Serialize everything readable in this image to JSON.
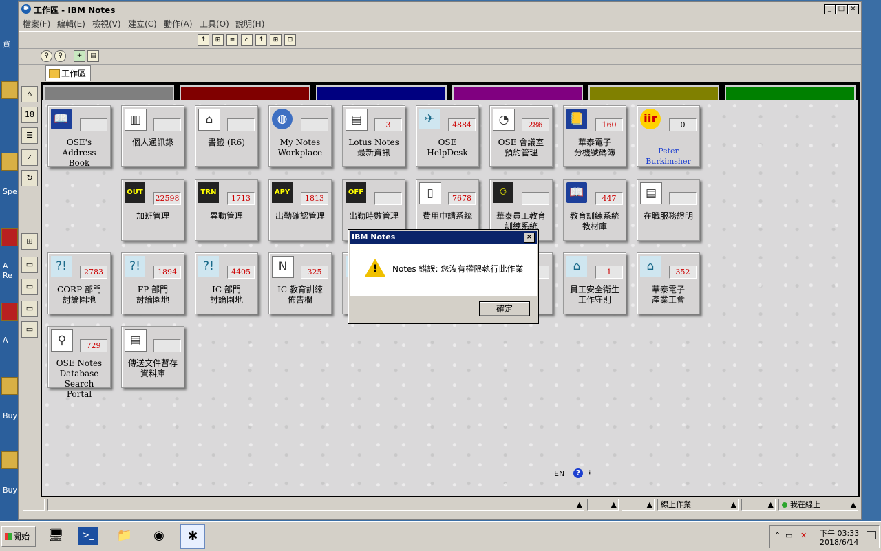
{
  "window": {
    "title": "工作區 - IBM Notes",
    "menus": [
      "檔案(F)",
      "編輯(E)",
      "檢視(V)",
      "建立(C)",
      "動作(A)",
      "工具(O)",
      "說明(H)"
    ],
    "tab_label": "工作區"
  },
  "desktop": {
    "labels": [
      "資",
      "Spe",
      "A",
      "Re",
      "A",
      "Buy",
      "Buy"
    ]
  },
  "colors": {
    "tab_colors": [
      "#7f7f7f",
      "#800000",
      "#000080",
      "#800080",
      "#808000",
      "#008000"
    ]
  },
  "tiles": [
    {
      "icon": "address-book-icon",
      "count": "",
      "label": "OSE's Address\nBook"
    },
    {
      "icon": "contacts-icon",
      "count": "",
      "label": "個人通訊錄"
    },
    {
      "icon": "bookmarks-icon",
      "count": "",
      "label": "書籤 (R6)"
    },
    {
      "icon": "workplace-globe-icon",
      "count": "",
      "label": "My Notes\nWorkplace"
    },
    {
      "icon": "newspaper-icon",
      "count": "3",
      "label": "Lotus Notes\n最新資訊"
    },
    {
      "icon": "helpdesk-tools-icon",
      "count": "4884",
      "label": "OSE HelpDesk"
    },
    {
      "icon": "clock-icon",
      "count": "286",
      "label": "OSE 會議室\n預約管理"
    },
    {
      "icon": "phone-book-icon",
      "count": "160",
      "label": "華泰電子\n分機號碼簿"
    },
    {
      "icon": "user-logo-icon",
      "count": "0",
      "label": "Peter Burkimsher"
    },
    {
      "icon": "out-icon",
      "count": "22598",
      "label": "加班管理"
    },
    {
      "icon": "trn-icon",
      "count": "1713",
      "label": "異動管理"
    },
    {
      "icon": "apy-icon",
      "count": "1813",
      "label": "出勤確認管理"
    },
    {
      "icon": "off-icon",
      "count": "",
      "label": "出勤時數管理"
    },
    {
      "icon": "phone-icon",
      "count": "7678",
      "label": "費用申請系統"
    },
    {
      "icon": "training-icon",
      "count": "",
      "label": "華泰員工教育\n訓練系統"
    },
    {
      "icon": "course-book-icon",
      "count": "447",
      "label": "教育訓練系統\n教材庫"
    },
    {
      "icon": "certificate-icon",
      "count": "",
      "label": "在職服務證明"
    },
    {
      "icon": "discussion-icon",
      "count": "2783",
      "label": "CORP 部門\n討論園地"
    },
    {
      "icon": "discussion-icon",
      "count": "1894",
      "label": "FP 部門\n討論園地"
    },
    {
      "icon": "discussion-icon",
      "count": "4405",
      "label": "IC 部門\n討論園地"
    },
    {
      "icon": "bulletin-icon",
      "count": "325",
      "label": "IC 教育訓練\n佈告欄"
    },
    {
      "icon": "database-icon",
      "count": "",
      "label": ""
    },
    {
      "icon": "database-icon",
      "count": "",
      "label": ""
    },
    {
      "icon": "bank-icon",
      "count": "1",
      "label": "員工安全衛生\n工作守則"
    },
    {
      "icon": "bank-icon",
      "count": "352",
      "label": "華泰電子\n產業工會"
    },
    {
      "icon": "search-db-icon",
      "count": "729",
      "label": "OSE Notes\nDatabase Search\nPortal"
    },
    {
      "icon": "document-icon",
      "count": "",
      "label": "傳送文件暫存\n資料庫"
    }
  ],
  "dialog": {
    "title": "IBM Notes",
    "message": "Notes 錯誤: 您沒有權限執行此作業",
    "ok": "確定"
  },
  "statusbar": {
    "lang": "EN",
    "location": "線上作業",
    "presence": "我在線上"
  },
  "taskbar": {
    "start": "開始",
    "time": "下午 03:33",
    "date": "2018/6/14"
  }
}
